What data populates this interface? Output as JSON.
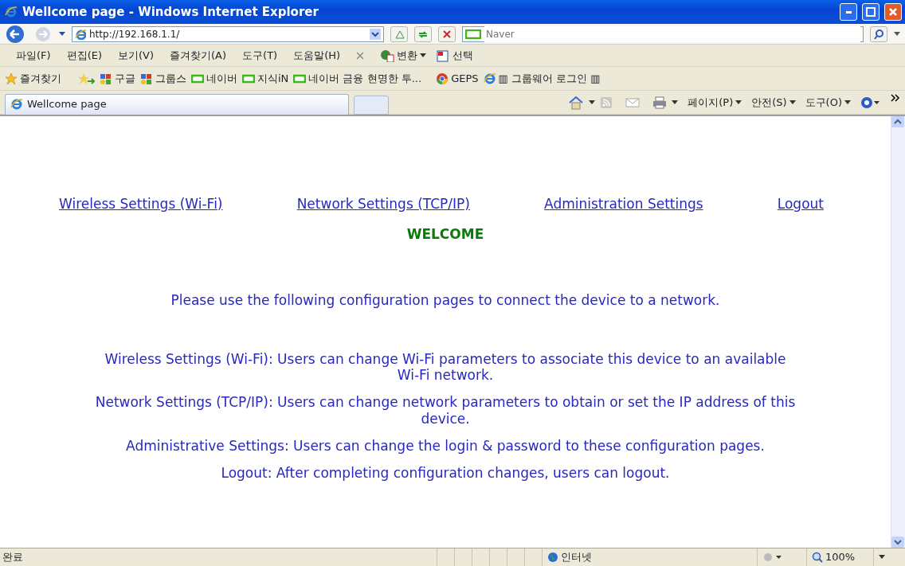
{
  "window": {
    "title": "Wellcome page - Windows Internet Explorer"
  },
  "address_bar": {
    "url": "http://192.168.1.1/",
    "search_placeholder": "Naver"
  },
  "menu": [
    "파일(F)",
    "편집(E)",
    "보기(V)",
    "즐겨찾기(A)",
    "도구(T)",
    "도움말(H)"
  ],
  "convert_bar": [
    {
      "label": "변환",
      "dropdown": true
    },
    {
      "label": "선택",
      "dropdown": false
    }
  ],
  "favorites_bar": {
    "label": "즐겨찾기",
    "links": [
      {
        "label": "구글",
        "kind": "google"
      },
      {
        "label": "그룹스",
        "kind": "google"
      },
      {
        "label": "네이버",
        "kind": "naver"
      },
      {
        "label": "지식iN",
        "kind": "naver"
      },
      {
        "label": "네이버 금융  현명한 투...",
        "kind": "naver"
      },
      {
        "label": "GEPS",
        "kind": "chrome"
      },
      {
        "label": "▥ 그룹웨어 로그인 ▥",
        "kind": "ie"
      }
    ]
  },
  "tab": {
    "title": "Wellcome page"
  },
  "command_bar": [
    "페이지(P)",
    "안전(S)",
    "도구(O)"
  ],
  "page": {
    "nav_links": [
      "Wireless Settings (Wi-Fi)",
      "Network Settings (TCP/IP)",
      "Administration Settings",
      "Logout"
    ],
    "heading": "WELCOME",
    "intro": "Please use the following configuration pages to connect the device to a network.",
    "descriptions": [
      "Wireless Settings (Wi-Fi): Users can change Wi-Fi parameters to associate this device to an available Wi-Fi network.",
      "Network Settings (TCP/IP): Users can change network parameters to obtain or set the IP address of this device.",
      "Administrative Settings: Users can change the login & password to these configuration pages.",
      "Logout: After completing configuration changes, users can logout."
    ]
  },
  "status_bar": {
    "status": "완료",
    "zone": "인터넷",
    "zoom": "100%"
  }
}
